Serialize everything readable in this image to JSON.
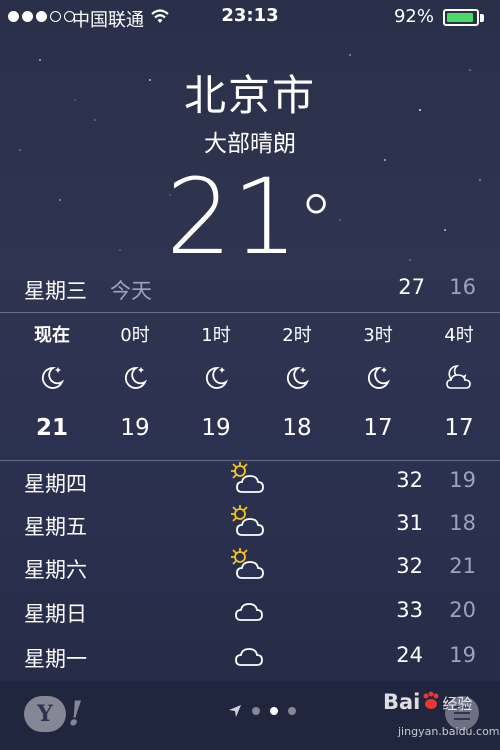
{
  "status_bar": {
    "carrier": "中国联通",
    "time": "23:13",
    "battery_percent": "92%",
    "battery_level": 0.92,
    "signal_bars": 3,
    "battery_color": "#4cd964"
  },
  "location": {
    "city": "北京市",
    "condition": "大部晴朗",
    "temperature": "21",
    "degree_symbol": "°"
  },
  "today": {
    "day": "星期三",
    "label": "今天",
    "high": "27",
    "low": "16"
  },
  "hourly": [
    {
      "time": "现在",
      "temp": "21",
      "icon": "moon-icon"
    },
    {
      "time": "0时",
      "temp": "19",
      "icon": "moon-icon"
    },
    {
      "time": "1时",
      "temp": "19",
      "icon": "moon-icon"
    },
    {
      "time": "2时",
      "temp": "18",
      "icon": "moon-icon"
    },
    {
      "time": "3时",
      "temp": "17",
      "icon": "moon-icon"
    },
    {
      "time": "4时",
      "temp": "17",
      "icon": "moon-cloud-icon"
    }
  ],
  "daily": [
    {
      "day": "星期四",
      "high": "32",
      "low": "19",
      "icon": "sun-cloud-icon"
    },
    {
      "day": "星期五",
      "high": "31",
      "low": "18",
      "icon": "sun-cloud-icon"
    },
    {
      "day": "星期六",
      "high": "32",
      "low": "21",
      "icon": "sun-cloud-icon"
    },
    {
      "day": "星期日",
      "high": "33",
      "low": "20",
      "icon": "cloud-icon"
    },
    {
      "day": "星期一",
      "high": "24",
      "low": "19",
      "icon": "cloud-icon"
    }
  ],
  "bottom_bar": {
    "yahoo_letter": "Y",
    "yahoo_bang": "!",
    "page_count": 3,
    "active_page": 1,
    "watermark": "Bai",
    "watermark_suffix": "经验",
    "watermark_url": "jingyan.baidu.com"
  }
}
